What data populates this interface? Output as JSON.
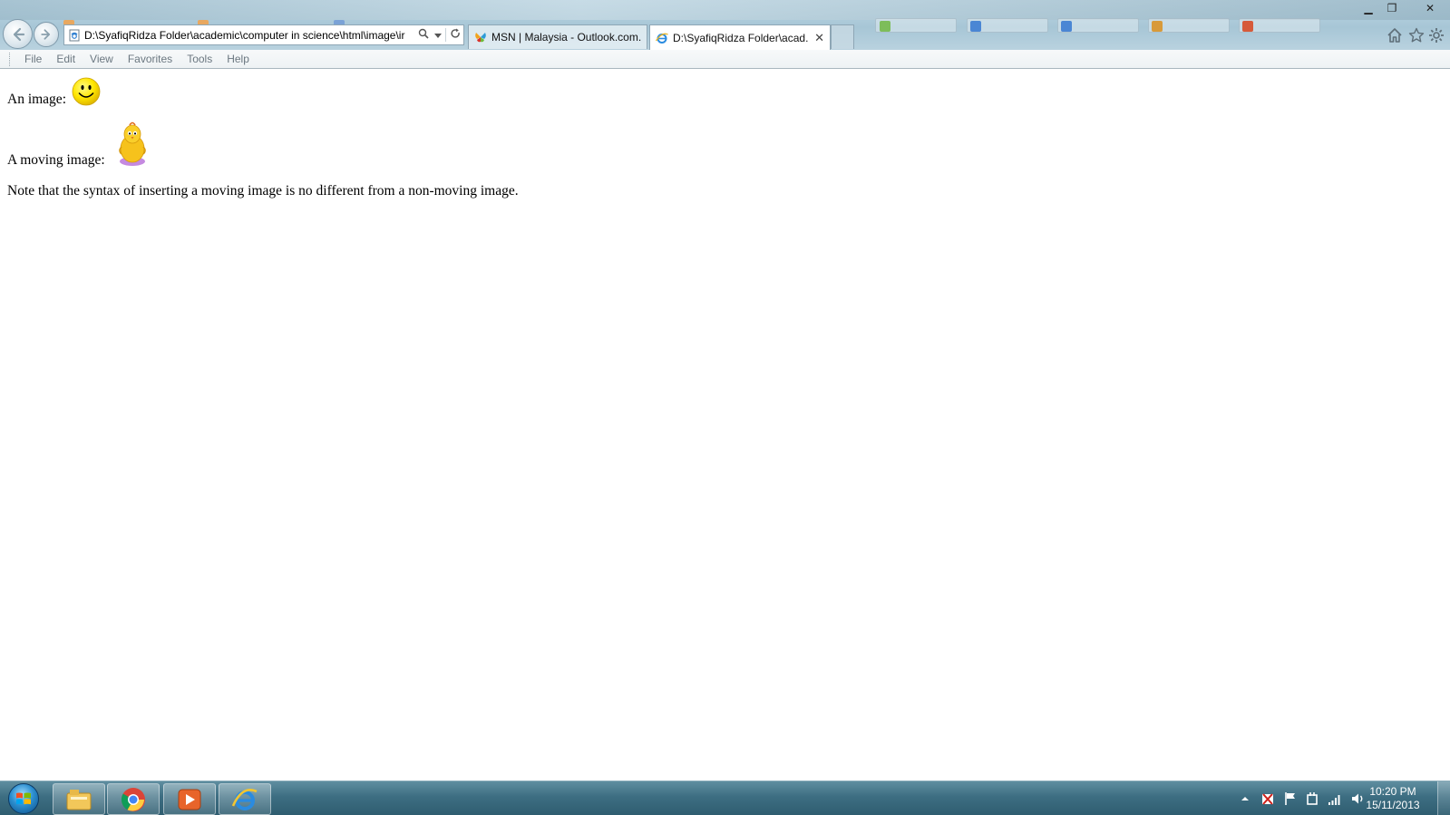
{
  "browser": {
    "address_url": "D:\\SyafiqRidza Folder\\academic\\computer in science\\html\\image\\ir",
    "tabs": [
      {
        "label": "MSN | Malaysia - Outlook.com...",
        "icon": "msn-butterfly-icon",
        "active": false
      },
      {
        "label": "D:\\SyafiqRidza Folder\\acad...",
        "icon": "ie-page-icon",
        "active": true
      }
    ],
    "close_glyph": "✕",
    "window_controls": {
      "minimize": "▁",
      "restore": "❐",
      "close": "✕"
    },
    "right_icons": [
      "home-icon",
      "favorites-star-icon",
      "tools-gear-icon"
    ]
  },
  "menubar": {
    "items": [
      "File",
      "Edit",
      "View",
      "Favorites",
      "Tools",
      "Help"
    ]
  },
  "page": {
    "line1_label": "An image:",
    "line2_label": "A moving image:",
    "note": "Note that the syntax of inserting a moving image is no different from a non-moving image."
  },
  "taskbar": {
    "pinned": [
      "windows-explorer-icon",
      "chrome-icon",
      "media-player-icon",
      "internet-explorer-icon"
    ],
    "tray_icons": [
      "show-hidden-icons-arrow",
      "action-center-flag-icon",
      "power-icon",
      "network-signal-icon",
      "volume-icon"
    ],
    "time": "10:20 PM",
    "date": "15/11/2013"
  },
  "colors": {
    "titlebar": "#a7c6d6",
    "taskbar": "#3d6e82",
    "smiley": "#ffe600",
    "chick": "#f6c21c"
  }
}
